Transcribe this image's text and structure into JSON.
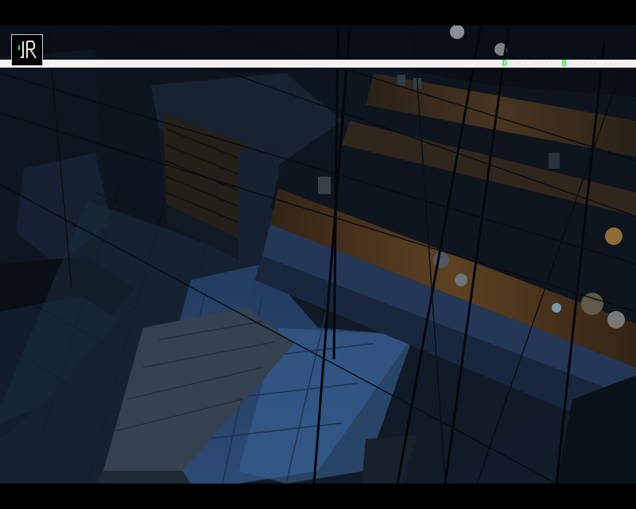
{
  "logo": {
    "icon": "jr-monogram-icon",
    "text": "JR"
  },
  "tagline": {
    "parts": [
      {
        "text": "D",
        "highlight": true
      },
      {
        "text": "oubt more.",
        "highlight": false
      },
      {
        "text": "B",
        "highlight": true
      },
      {
        "text": "elieve less.",
        "highlight": false
      }
    ]
  },
  "colors": {
    "accent": "#39e84a",
    "bar": "#f2f2f2",
    "letterbox": "#000000"
  }
}
